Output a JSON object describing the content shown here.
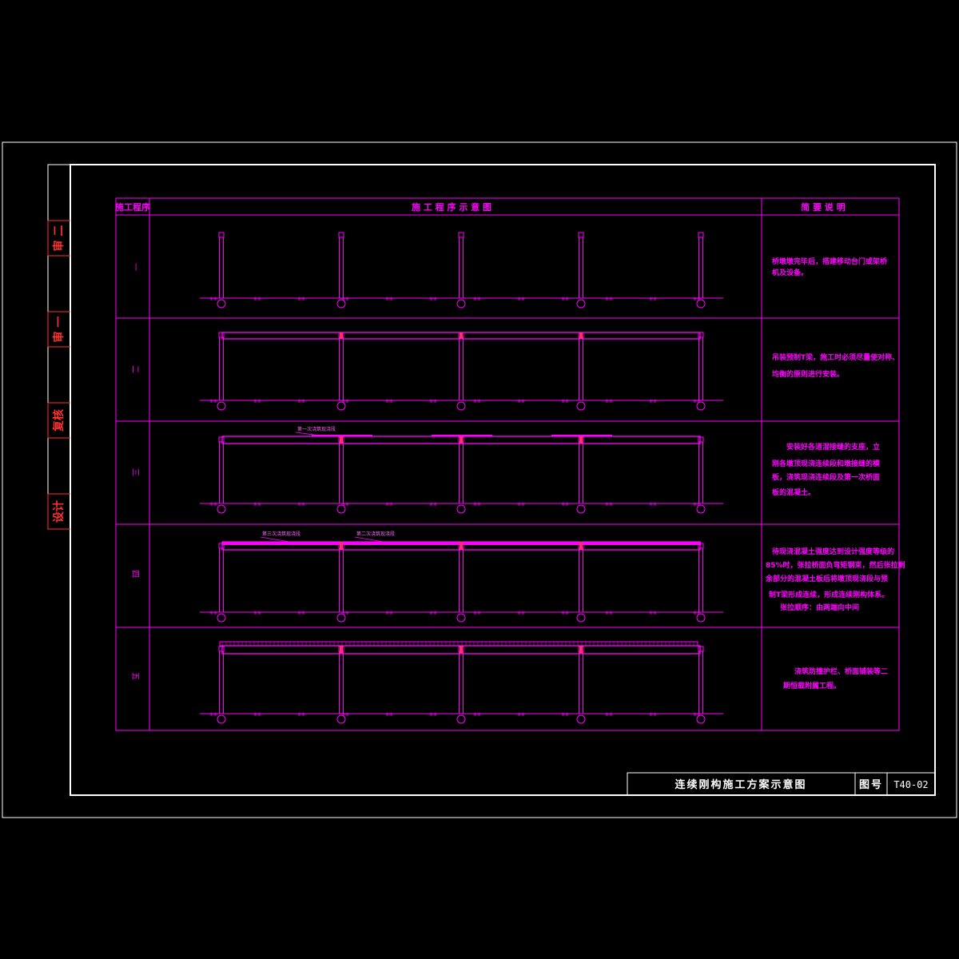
{
  "title_block": {
    "drawing_title": "连续刚构施工方案示意图",
    "drawing_no_label": "图号",
    "drawing_no": "T40-02"
  },
  "side_block": {
    "labels": [
      "审 二",
      "审 一",
      "复核",
      "设计"
    ]
  },
  "table": {
    "headers": {
      "step": "施工程序",
      "diagram": "施 工 程 序 示 意 图",
      "notes": "简 要 说 明"
    },
    "rows": [
      {
        "step": "一",
        "lines": [
          "桥墩墩完毕后，搭建移动台门或架桥",
          "机及设备。"
        ]
      },
      {
        "step": "二",
        "lines": [
          "吊装预制T梁，施工时必须尽量使对称、",
          "均衡的原则进行安装。"
        ]
      },
      {
        "step": "三",
        "lines": [
          "安装好各道湿接缝的支座，立",
          "刚各墩顶现浇连续段和墩接缝的模",
          "板，浇筑现浇连续段及第一次桥面",
          "板的混凝土。"
        ]
      },
      {
        "step": "四",
        "lines": [
          "待现浇混凝土强度达到设计强度等级的",
          "85%时，张拉桥面负弯矩钢束，然后张拉剩",
          "余部分的混凝土板后将墩顶现浇段与预",
          "制T梁形成连续，形成连续刚构体系。",
          "张拉顺序：由两端向中间"
        ]
      },
      {
        "step": "五",
        "lines": [
          "浇筑防撞护栏、桥面铺装等二",
          "期恒载附属工程。"
        ]
      }
    ],
    "pier_labels": [
      "①",
      "②",
      "③",
      "④",
      "⑤"
    ],
    "pour_labels": {
      "row3_first": "第一次浇筑现浇段",
      "row4_third": "第三次浇筑现浇段",
      "row4_second": "第二次浇筑现浇段"
    }
  },
  "colors": {
    "line": "#ff00ff",
    "frame": "#ffffff",
    "side_text": "#ff3030",
    "background": "#000000"
  }
}
